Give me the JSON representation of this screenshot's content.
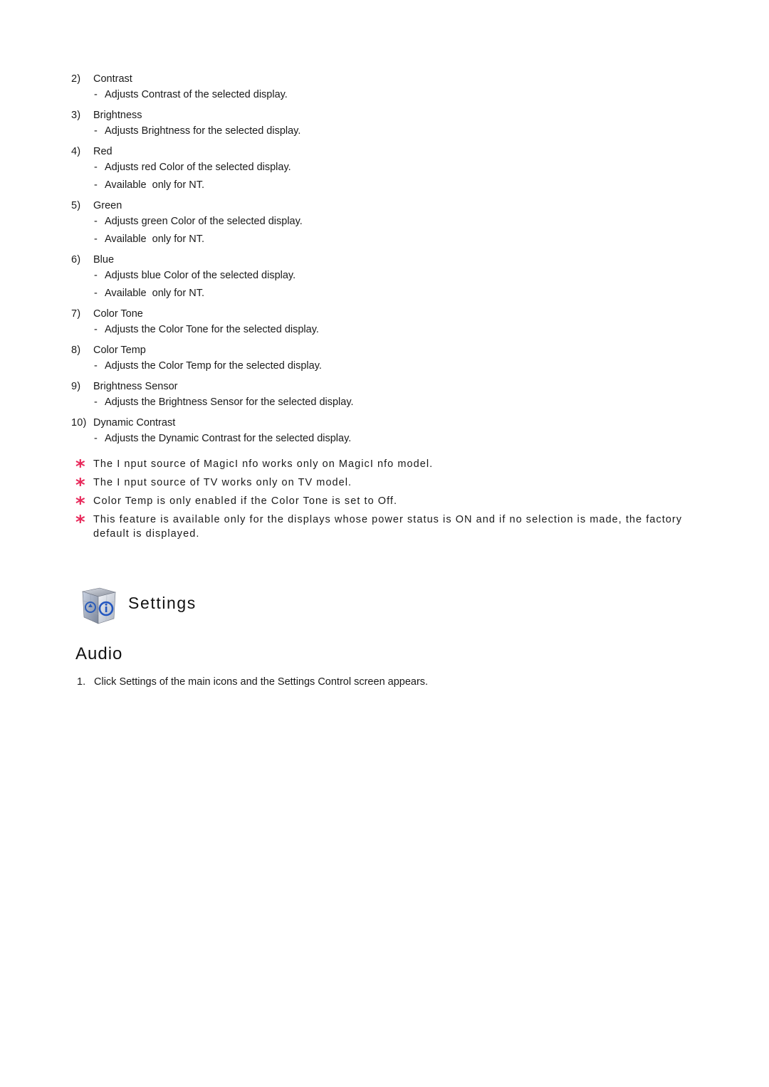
{
  "items": [
    {
      "num": "2)",
      "title": "Contrast",
      "desc": [
        "Adjusts Contrast of the selected display."
      ]
    },
    {
      "num": "3)",
      "title": "Brightness",
      "desc": [
        "Adjusts Brightness for the selected display."
      ]
    },
    {
      "num": "4)",
      "title": "Red",
      "desc": [
        "Adjusts red Color of the selected display.",
        "Available  only for NT."
      ]
    },
    {
      "num": "5)",
      "title": "Green",
      "desc": [
        "Adjusts green Color of the selected display.",
        "Available  only for NT."
      ]
    },
    {
      "num": "6)",
      "title": "Blue",
      "desc": [
        "Adjusts blue Color of the selected display.",
        "Available  only for NT."
      ]
    },
    {
      "num": "7)",
      "title": "Color Tone",
      "desc": [
        "Adjusts the Color Tone for the selected display."
      ]
    },
    {
      "num": "8)",
      "title": "Color Temp",
      "desc": [
        "Adjusts the Color Temp for the selected display."
      ]
    },
    {
      "num": "9)",
      "title": "Brightness Sensor",
      "desc": [
        "Adjusts the Brightness Sensor for the selected display."
      ]
    },
    {
      "num": "10)",
      "title": "Dynamic Contrast",
      "desc": [
        "Adjusts the Dynamic Contrast for the selected display."
      ]
    }
  ],
  "dash": "-",
  "note_marker": "*",
  "notes": [
    "The I nput source of MagicI nfo works only on MagicI nfo model.",
    "The I nput source of TV works only on TV model.",
    "Color Temp is only enabled if the Color Tone is set to Off.",
    "This feature is available only for the displays whose power status is ON and if no selection is made, the factory default is displayed."
  ],
  "section": {
    "icon": "settings-cube-icon",
    "title": "Settings"
  },
  "subsection": {
    "title": "Audio",
    "steps": [
      {
        "num": "1.",
        "text": "Click Settings of the main icons and the Settings Control screen appears."
      }
    ]
  },
  "colors": {
    "note_marker": "#e8285a",
    "text": "#1a1a1a"
  }
}
